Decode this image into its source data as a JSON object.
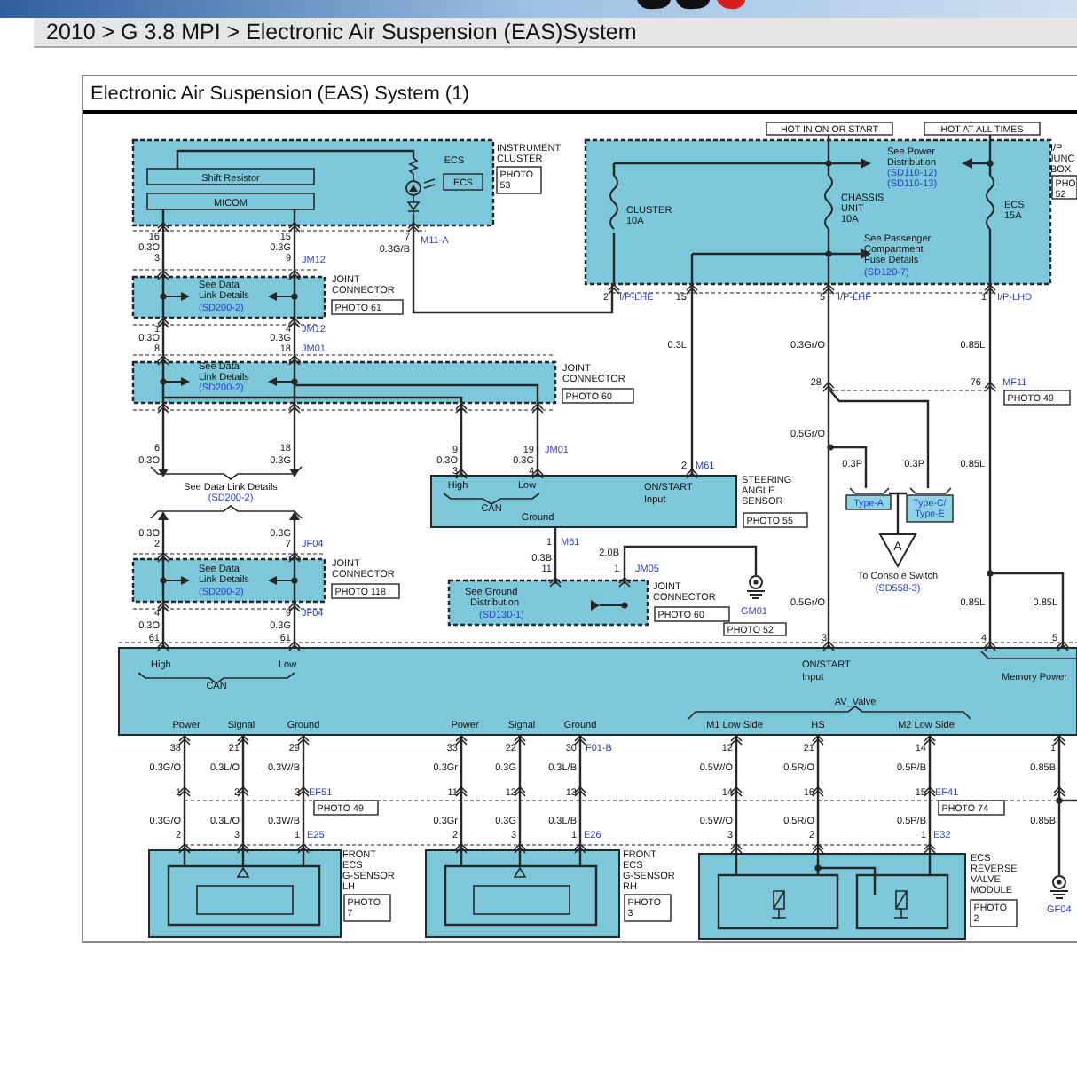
{
  "page": {
    "breadcrumb": "2010 > G 3.8 MPI > Electronic Air Suspension (EAS)System"
  },
  "diagram": {
    "title": "Electronic Air Suspension (EAS) System (1)",
    "labels": [
      {
        "kind": "note",
        "text": "HOT IN ON OR START"
      },
      {
        "kind": "note",
        "text": "HOT AT ALL TIMES"
      },
      {
        "kind": "name",
        "text": "Shift Resistor"
      },
      {
        "kind": "name",
        "text": "MICOM"
      },
      {
        "kind": "name",
        "text": "ECS"
      },
      {
        "kind": "boxed",
        "text": "ECS"
      },
      {
        "kind": "name",
        "text": "INSTRUMENT"
      },
      {
        "kind": "name",
        "text": "CLUSTER"
      },
      {
        "kind": "photo",
        "lines": [
          "PHOTO",
          "53"
        ]
      },
      {
        "kind": "name",
        "text": "See Power"
      },
      {
        "kind": "name",
        "text": "Distribution"
      },
      {
        "kind": "ref",
        "text": "(SD110-12)"
      },
      {
        "kind": "ref",
        "text": "(SD110-13)"
      },
      {
        "kind": "name",
        "text": "CLUSTER"
      },
      {
        "kind": "name",
        "text": "10A"
      },
      {
        "kind": "name",
        "text": "CHASSIS"
      },
      {
        "kind": "name",
        "text": "UNIT"
      },
      {
        "kind": "name",
        "text": "10A"
      },
      {
        "kind": "name",
        "text": "ECS"
      },
      {
        "kind": "name",
        "text": "15A"
      },
      {
        "kind": "name",
        "text": "See Passenger"
      },
      {
        "kind": "name",
        "text": "Compartment"
      },
      {
        "kind": "name",
        "text": "Fuse Details"
      },
      {
        "kind": "ref",
        "text": "(SD120-7)"
      },
      {
        "kind": "name",
        "text": "I/P"
      },
      {
        "kind": "name",
        "text": "JUNC"
      },
      {
        "kind": "name",
        "text": "BOX"
      },
      {
        "kind": "photo",
        "lines": [
          "PHO",
          "52"
        ]
      },
      {
        "kind": "pin",
        "text": "16"
      },
      {
        "kind": "wire",
        "text": "0.3O"
      },
      {
        "kind": "pin",
        "text": "3"
      },
      {
        "kind": "pin",
        "text": "15"
      },
      {
        "kind": "wire",
        "text": "0.3G"
      },
      {
        "kind": "pin",
        "text": "9"
      },
      {
        "kind": "connector",
        "text": "JM12"
      },
      {
        "kind": "pin",
        "text": "7"
      },
      {
        "kind": "connector",
        "text": "M11-A"
      },
      {
        "kind": "wire",
        "text": "0.3G/B"
      },
      {
        "kind": "name",
        "text": "See Data"
      },
      {
        "kind": "name",
        "text": "Link Details"
      },
      {
        "kind": "ref",
        "text": "(SD200-2)"
      },
      {
        "kind": "name",
        "text": "JOINT"
      },
      {
        "kind": "name",
        "text": "CONNECTOR"
      },
      {
        "kind": "photo",
        "lines": [
          "PHOTO 61"
        ]
      },
      {
        "kind": "pin",
        "text": "1"
      },
      {
        "kind": "wire",
        "text": "0.3O"
      },
      {
        "kind": "pin",
        "text": "8"
      },
      {
        "kind": "pin",
        "text": "4"
      },
      {
        "kind": "connector",
        "text": "JM12"
      },
      {
        "kind": "wire",
        "text": "0.3G"
      },
      {
        "kind": "pin",
        "text": "18"
      },
      {
        "kind": "connector",
        "text": "JM01"
      },
      {
        "kind": "name",
        "text": "See Data"
      },
      {
        "kind": "name",
        "text": "Link Details"
      },
      {
        "kind": "ref",
        "text": "(SD200-2)"
      },
      {
        "kind": "name",
        "text": "JOINT"
      },
      {
        "kind": "name",
        "text": "CONNECTOR"
      },
      {
        "kind": "photo",
        "lines": [
          "PHOTO 60"
        ]
      },
      {
        "kind": "pin",
        "text": "9"
      },
      {
        "kind": "wire",
        "text": "0.3O"
      },
      {
        "kind": "pin",
        "text": "3"
      },
      {
        "kind": "pin",
        "text": "19"
      },
      {
        "kind": "connector",
        "text": "JM01"
      },
      {
        "kind": "wire",
        "text": "0.3G"
      },
      {
        "kind": "pin",
        "text": "4"
      },
      {
        "kind": "pin",
        "text": "6"
      },
      {
        "kind": "wire",
        "text": "0.3O"
      },
      {
        "kind": "pin",
        "text": "18"
      },
      {
        "kind": "wire",
        "text": "0.3G"
      },
      {
        "kind": "name",
        "text": "See Data Link Details"
      },
      {
        "kind": "ref",
        "text": "(SD200-2)"
      },
      {
        "kind": "wire",
        "text": "0.3O"
      },
      {
        "kind": "pin",
        "text": "2"
      },
      {
        "kind": "wire",
        "text": "0.3G"
      },
      {
        "kind": "pin",
        "text": "7"
      },
      {
        "kind": "connector",
        "text": "JF04"
      },
      {
        "kind": "name",
        "text": "See Data"
      },
      {
        "kind": "name",
        "text": "Link Details"
      },
      {
        "kind": "ref",
        "text": "(SD200-2)"
      },
      {
        "kind": "name",
        "text": "JOINT"
      },
      {
        "kind": "name",
        "text": "CONNECTOR"
      },
      {
        "kind": "photo",
        "lines": [
          "PHOTO 118"
        ]
      },
      {
        "kind": "pin",
        "text": "4"
      },
      {
        "kind": "wire",
        "text": "0.3O"
      },
      {
        "kind": "pin",
        "text": "61"
      },
      {
        "kind": "pin",
        "text": "9"
      },
      {
        "kind": "connector",
        "text": "JF04"
      },
      {
        "kind": "wire",
        "text": "0.3G"
      },
      {
        "kind": "pin",
        "text": "61"
      },
      {
        "kind": "pin",
        "text": "2"
      },
      {
        "kind": "connector",
        "text": "I/P-LHE"
      },
      {
        "kind": "pin",
        "text": "15"
      },
      {
        "kind": "pin",
        "text": "5"
      },
      {
        "kind": "connector",
        "text": "I/P-LHF"
      },
      {
        "kind": "pin",
        "text": "1"
      },
      {
        "kind": "connector",
        "text": "I/P-LHD"
      },
      {
        "kind": "wire",
        "text": "0.3L"
      },
      {
        "kind": "wire",
        "text": "0.3Gr/O"
      },
      {
        "kind": "wire",
        "text": "0.85L"
      },
      {
        "kind": "pin",
        "text": "28"
      },
      {
        "kind": "pin",
        "text": "76"
      },
      {
        "kind": "connector",
        "text": "MF11"
      },
      {
        "kind": "photo",
        "lines": [
          "PHOTO 49"
        ]
      },
      {
        "kind": "wire",
        "text": "0.5Gr/O"
      },
      {
        "kind": "pin",
        "text": "2"
      },
      {
        "kind": "connector",
        "text": "M61"
      },
      {
        "kind": "wire",
        "text": "0.3P"
      },
      {
        "kind": "wire",
        "text": "0.3P"
      },
      {
        "kind": "wire",
        "text": "0.85L"
      },
      {
        "kind": "signal",
        "text": "High"
      },
      {
        "kind": "signal",
        "text": "Low"
      },
      {
        "kind": "signal",
        "text": "CAN"
      },
      {
        "kind": "signal",
        "text": "Ground"
      },
      {
        "kind": "signal",
        "text": "ON/START"
      },
      {
        "kind": "signal",
        "text": "Input"
      },
      {
        "kind": "name",
        "text": "STEERING"
      },
      {
        "kind": "name",
        "text": "ANGLE"
      },
      {
        "kind": "name",
        "text": "SENSOR"
      },
      {
        "kind": "photo",
        "lines": [
          "PHOTO 55"
        ]
      },
      {
        "kind": "tag",
        "lines": [
          "Type-A"
        ]
      },
      {
        "kind": "tag",
        "lines": [
          "Type-C/",
          "Type-E"
        ]
      },
      {
        "kind": "symbol",
        "text": "A"
      },
      {
        "kind": "name",
        "text": "To Console Switch"
      },
      {
        "kind": "ref",
        "text": "(SD558-3)"
      },
      {
        "kind": "pin",
        "text": "1"
      },
      {
        "kind": "connector",
        "text": "M61"
      },
      {
        "kind": "wire",
        "text": "0.3B"
      },
      {
        "kind": "pin",
        "text": "11"
      },
      {
        "kind": "wire",
        "text": "2.0B"
      },
      {
        "kind": "pin",
        "text": "1"
      },
      {
        "kind": "connector",
        "text": "JM05"
      },
      {
        "kind": "name",
        "text": "See Ground"
      },
      {
        "kind": "name",
        "text": "Distribution"
      },
      {
        "kind": "ref",
        "text": "(SD130-1)"
      },
      {
        "kind": "name",
        "text": "JOINT"
      },
      {
        "kind": "name",
        "text": "CONNECTOR"
      },
      {
        "kind": "photo",
        "lines": [
          "PHOTO 60"
        ]
      },
      {
        "kind": "connector",
        "text": "GM01"
      },
      {
        "kind": "photo",
        "lines": [
          "PHOTO 52"
        ]
      },
      {
        "kind": "wire",
        "text": "0.5Gr/O"
      },
      {
        "kind": "wire",
        "text": "0.85L"
      },
      {
        "kind": "wire",
        "text": "0.85L"
      },
      {
        "kind": "pin",
        "text": "3"
      },
      {
        "kind": "pin",
        "text": "4"
      },
      {
        "kind": "pin",
        "text": "5"
      },
      {
        "kind": "signal",
        "text": "High"
      },
      {
        "kind": "signal",
        "text": "Low"
      },
      {
        "kind": "signal",
        "text": "CAN"
      },
      {
        "kind": "signal",
        "text": "ON/START"
      },
      {
        "kind": "signal",
        "text": "Input"
      },
      {
        "kind": "signal",
        "text": "Memory Power"
      },
      {
        "kind": "signal",
        "text": "AV_Valve"
      },
      {
        "kind": "signal",
        "text": "Power"
      },
      {
        "kind": "signal",
        "text": "Signal"
      },
      {
        "kind": "signal",
        "text": "Ground"
      },
      {
        "kind": "signal",
        "text": "Power"
      },
      {
        "kind": "signal",
        "text": "Signal"
      },
      {
        "kind": "signal",
        "text": "Ground"
      },
      {
        "kind": "signal",
        "text": "M1 Low Side"
      },
      {
        "kind": "signal",
        "text": "HS"
      },
      {
        "kind": "signal",
        "text": "M2 Low Side"
      },
      {
        "kind": "pin",
        "text": "38"
      },
      {
        "kind": "pin",
        "text": "21"
      },
      {
        "kind": "pin",
        "text": "29"
      },
      {
        "kind": "pin",
        "text": "33"
      },
      {
        "kind": "pin",
        "text": "22"
      },
      {
        "kind": "pin",
        "text": "30"
      },
      {
        "kind": "connector",
        "text": "F01-B"
      },
      {
        "kind": "pin",
        "text": "12"
      },
      {
        "kind": "pin",
        "text": "21"
      },
      {
        "kind": "pin",
        "text": "14"
      },
      {
        "kind": "pin",
        "text": "1"
      },
      {
        "kind": "wire",
        "text": "0.3G/O"
      },
      {
        "kind": "wire",
        "text": "0.3L/O"
      },
      {
        "kind": "wire",
        "text": "0.3W/B"
      },
      {
        "kind": "wire",
        "text": "0.3Gr"
      },
      {
        "kind": "wire",
        "text": "0.3G"
      },
      {
        "kind": "wire",
        "text": "0.3L/B"
      },
      {
        "kind": "wire",
        "text": "0.5W/O"
      },
      {
        "kind": "wire",
        "text": "0.5R/O"
      },
      {
        "kind": "wire",
        "text": "0.5P/B"
      },
      {
        "kind": "wire",
        "text": "0.85B"
      },
      {
        "kind": "pin",
        "text": "1"
      },
      {
        "kind": "pin",
        "text": "2"
      },
      {
        "kind": "pin",
        "text": "3"
      },
      {
        "kind": "connector",
        "text": "EF51"
      },
      {
        "kind": "pin",
        "text": "11"
      },
      {
        "kind": "pin",
        "text": "12"
      },
      {
        "kind": "pin",
        "text": "13"
      },
      {
        "kind": "pin",
        "text": "14"
      },
      {
        "kind": "pin",
        "text": "16"
      },
      {
        "kind": "pin",
        "text": "15"
      },
      {
        "kind": "connector",
        "text": "EF41"
      },
      {
        "kind": "photo",
        "lines": [
          "PHOTO 49"
        ]
      },
      {
        "kind": "photo",
        "lines": [
          "PHOTO 74"
        ]
      },
      {
        "kind": "wire",
        "text": "0.3G/O"
      },
      {
        "kind": "wire",
        "text": "0.3L/O"
      },
      {
        "kind": "wire",
        "text": "0.3W/B"
      },
      {
        "kind": "wire",
        "text": "0.3Gr"
      },
      {
        "kind": "wire",
        "text": "0.3G"
      },
      {
        "kind": "wire",
        "text": "0.3L/B"
      },
      {
        "kind": "wire",
        "text": "0.5W/O"
      },
      {
        "kind": "wire",
        "text": "0.5R/O"
      },
      {
        "kind": "wire",
        "text": "0.5P/B"
      },
      {
        "kind": "wire",
        "text": "0.85B"
      },
      {
        "kind": "pin",
        "text": "2"
      },
      {
        "kind": "pin",
        "text": "3"
      },
      {
        "kind": "pin",
        "text": "1"
      },
      {
        "kind": "connector",
        "text": "E25"
      },
      {
        "kind": "pin",
        "text": "2"
      },
      {
        "kind": "pin",
        "text": "3"
      },
      {
        "kind": "pin",
        "text": "1"
      },
      {
        "kind": "connector",
        "text": "E26"
      },
      {
        "kind": "pin",
        "text": "3"
      },
      {
        "kind": "pin",
        "text": "2"
      },
      {
        "kind": "pin",
        "text": "1"
      },
      {
        "kind": "connector",
        "text": "E32"
      },
      {
        "kind": "name",
        "text": "FRONT"
      },
      {
        "kind": "name",
        "text": "ECS"
      },
      {
        "kind": "name",
        "text": "G-SENSOR"
      },
      {
        "kind": "name",
        "text": "LH"
      },
      {
        "kind": "photo",
        "lines": [
          "PHOTO",
          "7"
        ]
      },
      {
        "kind": "name",
        "text": "FRONT"
      },
      {
        "kind": "name",
        "text": "ECS"
      },
      {
        "kind": "name",
        "text": "G-SENSOR"
      },
      {
        "kind": "name",
        "text": "RH"
      },
      {
        "kind": "photo",
        "lines": [
          "PHOTO",
          "3"
        ]
      },
      {
        "kind": "name",
        "text": "ECS"
      },
      {
        "kind": "name",
        "text": "REVERSE"
      },
      {
        "kind": "name",
        "text": "VALVE"
      },
      {
        "kind": "name",
        "text": "MODULE"
      },
      {
        "kind": "photo",
        "lines": [
          "PHOTO",
          "2"
        ]
      },
      {
        "kind": "connector",
        "text": "GF04"
      }
    ]
  }
}
